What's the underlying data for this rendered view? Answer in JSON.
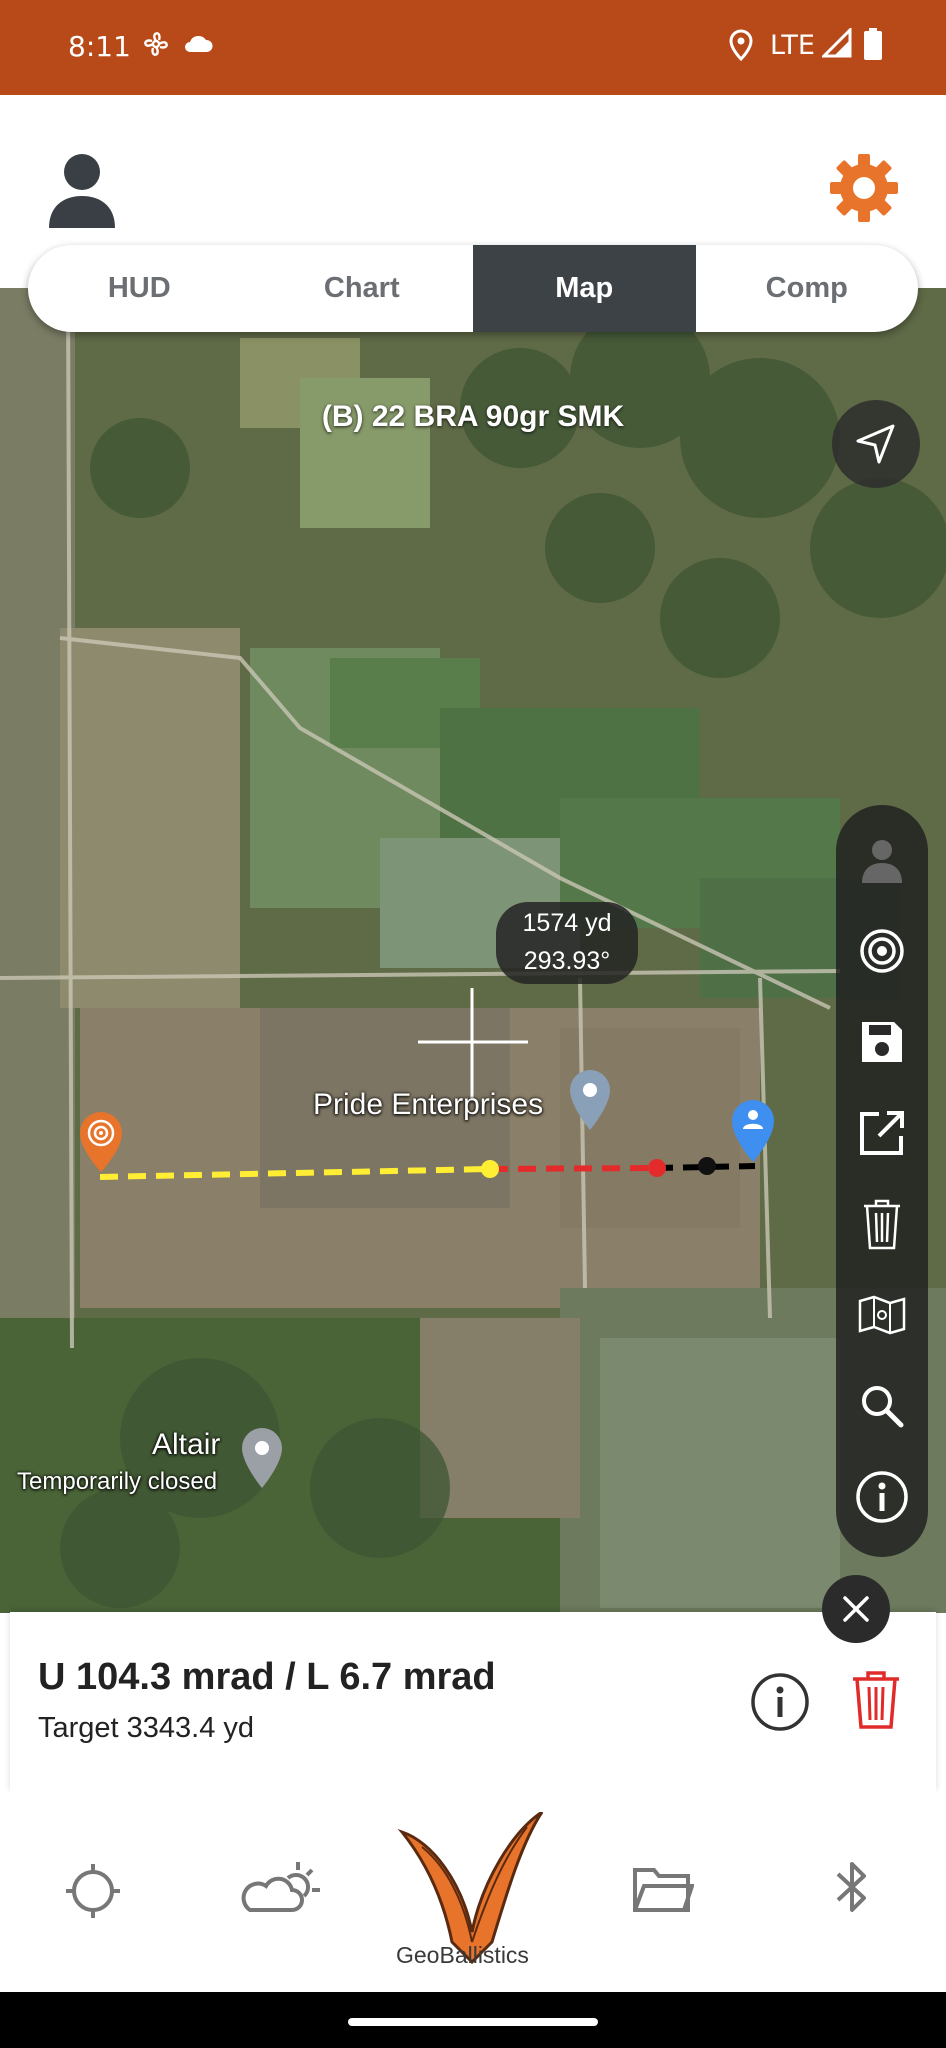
{
  "status_bar": {
    "time": "8:11",
    "network": "LTE",
    "icons": [
      "fan-icon",
      "cloud-icon",
      "location-icon",
      "signal-icon",
      "battery-icon"
    ]
  },
  "header": {
    "profile_icon": "person-icon",
    "settings_icon": "gear-icon",
    "accent": "#E8732A"
  },
  "tabs": [
    {
      "label": "HUD",
      "active": false
    },
    {
      "label": "Chart",
      "active": false
    },
    {
      "label": "Map",
      "active": true
    },
    {
      "label": "Comp",
      "active": false
    }
  ],
  "map": {
    "profile_name": "(B) 22 BRA 90gr SMK",
    "readout": {
      "distance": "1574 yd",
      "bearing": "293.93°"
    },
    "places": [
      {
        "name": "Pride Enterprises",
        "sub": ""
      },
      {
        "name": "Altair",
        "sub": "Temporarily closed"
      }
    ],
    "toolbar": [
      "person-icon",
      "target-icon",
      "save-icon",
      "share-icon",
      "trash-icon",
      "map-icon",
      "search-icon",
      "info-icon"
    ]
  },
  "result": {
    "main": "U 104.3 mrad / L 6.7 mrad",
    "sub": "Target 3343.4 yd"
  },
  "bottom_nav": {
    "items": [
      "crosshair-icon",
      "weather-icon",
      "geoballistics-logo",
      "folder-icon",
      "bluetooth-icon"
    ],
    "logo_text": "GeoBallistics"
  }
}
